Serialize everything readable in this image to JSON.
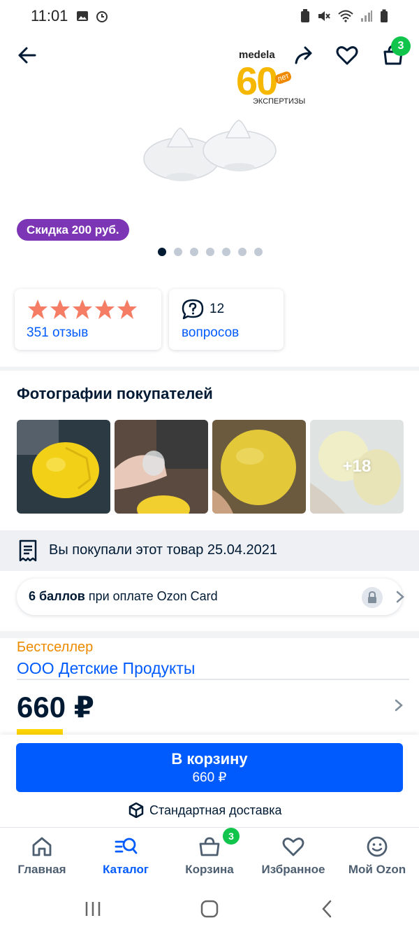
{
  "status_bar": {
    "time": "11:01"
  },
  "header": {
    "brand": "medela",
    "brand_badge": "60",
    "brand_years": "лет",
    "brand_sub": "ЭКСПЕРТИЗЫ",
    "cart_count": "3"
  },
  "gallery": {
    "discount": "Скидка 200 руб.",
    "slides": 7,
    "active_slide": 1
  },
  "rating": {
    "stars": 5,
    "reviews": "351 отзыв"
  },
  "questions": {
    "count": "12",
    "label": "вопросов"
  },
  "photos_section": {
    "title": "Фотографии покупателей",
    "more": "+18"
  },
  "purchased": {
    "text": "Вы покупали этот товар 25.04.2021"
  },
  "points": {
    "bold": "6 баллов",
    "rest": " при оплате Ozon Card"
  },
  "seller": {
    "badge": "Бестселлер",
    "name": "ООО Детские Продукты"
  },
  "price": {
    "value": "660 ₽"
  },
  "cta": {
    "label": "В корзину",
    "price": "660 ₽"
  },
  "delivery": {
    "label": "Стандартная доставка"
  },
  "tabs": [
    {
      "label": "Главная",
      "icon": "home-icon",
      "active": false
    },
    {
      "label": "Каталог",
      "icon": "catalog-search-icon",
      "active": true
    },
    {
      "label": "Корзина",
      "icon": "basket-icon",
      "active": false
    },
    {
      "label": "Избранное",
      "icon": "heart-icon",
      "active": false
    },
    {
      "label": "Мой Ozon",
      "icon": "smile-icon",
      "active": false
    }
  ],
  "tab_cart_badge": "3",
  "colors": {
    "accent": "#005bff",
    "discount": "#7c35b4",
    "badge": "#10c44c",
    "star": "#f57d66",
    "bestseller": "#ed8b00"
  }
}
